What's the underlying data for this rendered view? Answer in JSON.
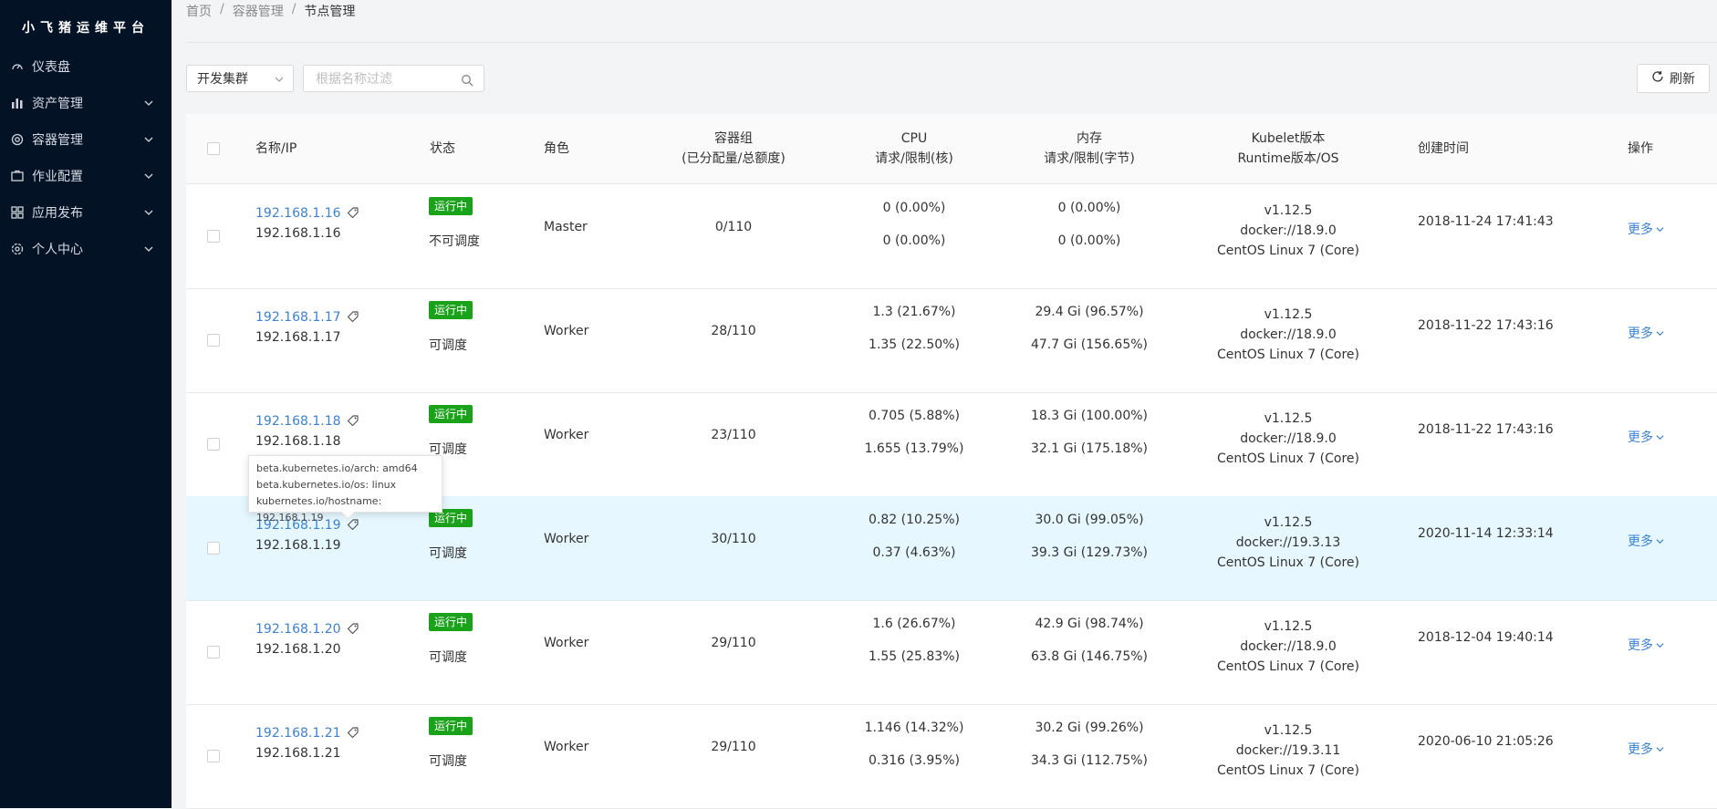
{
  "app": {
    "title": "小飞猪运维平台"
  },
  "sidebar": {
    "items": [
      {
        "label": "仪表盘",
        "icon": "dashboard-icon",
        "expandable": false
      },
      {
        "label": "资产管理",
        "icon": "bar-chart-icon",
        "expandable": true
      },
      {
        "label": "容器管理",
        "icon": "container-icon",
        "expandable": true
      },
      {
        "label": "作业配置",
        "icon": "job-icon",
        "expandable": true
      },
      {
        "label": "应用发布",
        "icon": "app-icon",
        "expandable": true
      },
      {
        "label": "个人中心",
        "icon": "user-settings-icon",
        "expandable": true
      }
    ]
  },
  "breadcrumb": [
    "首页",
    "容器管理",
    "节点管理"
  ],
  "toolbar": {
    "cluster_select": "开发集群",
    "search_placeholder": "根据名称过滤",
    "refresh_label": "刷新"
  },
  "table": {
    "headers": {
      "name": "名称/IP",
      "status": "状态",
      "role": "角色",
      "pods_1": "容器组",
      "pods_2": "(已分配量/总额度)",
      "cpu_1": "CPU",
      "cpu_2": "请求/限制(核)",
      "mem_1": "内存",
      "mem_2": "请求/限制(字节)",
      "kubelet_1": "Kubelet版本",
      "kubelet_2": "Runtime版本/OS",
      "created": "创建时间",
      "actions": "操作"
    },
    "rows": [
      {
        "name": "192.168.1.16",
        "ip": "192.168.1.16",
        "status": "运行中",
        "schedule": "不可调度",
        "role": "Master",
        "pods": "0/110",
        "cpu_req": "0 (0.00%)",
        "cpu_lim": "0 (0.00%)",
        "mem_req": "0 (0.00%)",
        "mem_lim": "0 (0.00%)",
        "kubelet": "v1.12.5",
        "runtime": "docker://18.9.0",
        "os": "CentOS Linux 7 (Core)",
        "created": "2018-11-24 17:41:43",
        "action": "更多"
      },
      {
        "name": "192.168.1.17",
        "ip": "192.168.1.17",
        "status": "运行中",
        "schedule": "可调度",
        "role": "Worker",
        "pods": "28/110",
        "cpu_req": "1.3 (21.67%)",
        "cpu_lim": "1.35 (22.50%)",
        "mem_req": "29.4 Gi (96.57%)",
        "mem_lim": "47.7 Gi (156.65%)",
        "kubelet": "v1.12.5",
        "runtime": "docker://18.9.0",
        "os": "CentOS Linux 7 (Core)",
        "created": "2018-11-22 17:43:16",
        "action": "更多"
      },
      {
        "name": "192.168.1.18",
        "ip": "192.168.1.18",
        "status": "运行中",
        "schedule": "可调度",
        "role": "Worker",
        "pods": "23/110",
        "cpu_req": "0.705 (5.88%)",
        "cpu_lim": "1.655 (13.79%)",
        "mem_req": "18.3 Gi (100.00%)",
        "mem_lim": "32.1 Gi (175.18%)",
        "kubelet": "v1.12.5",
        "runtime": "docker://18.9.0",
        "os": "CentOS Linux 7 (Core)",
        "created": "2018-11-22 17:43:16",
        "action": "更多"
      },
      {
        "name": "192.168.1.19",
        "ip": "192.168.1.19",
        "status": "运行中",
        "schedule": "可调度",
        "role": "Worker",
        "pods": "30/110",
        "cpu_req": "0.82 (10.25%)",
        "cpu_lim": "0.37 (4.63%)",
        "mem_req": "30.0 Gi (99.05%)",
        "mem_lim": "39.3 Gi (129.73%)",
        "kubelet": "v1.12.5",
        "runtime": "docker://19.3.13",
        "os": "CentOS Linux 7 (Core)",
        "created": "2020-11-14 12:33:14",
        "action": "更多"
      },
      {
        "name": "192.168.1.20",
        "ip": "192.168.1.20",
        "status": "运行中",
        "schedule": "可调度",
        "role": "Worker",
        "pods": "29/110",
        "cpu_req": "1.6 (26.67%)",
        "cpu_lim": "1.55 (25.83%)",
        "mem_req": "42.9 Gi (98.74%)",
        "mem_lim": "63.8 Gi (146.75%)",
        "kubelet": "v1.12.5",
        "runtime": "docker://18.9.0",
        "os": "CentOS Linux 7 (Core)",
        "created": "2018-12-04 19:40:14",
        "action": "更多"
      },
      {
        "name": "192.168.1.21",
        "ip": "192.168.1.21",
        "status": "运行中",
        "schedule": "可调度",
        "role": "Worker",
        "pods": "29/110",
        "cpu_req": "1.146 (14.32%)",
        "cpu_lim": "0.316 (3.95%)",
        "mem_req": "30.2 Gi (99.26%)",
        "mem_lim": "34.3 Gi (112.75%)",
        "kubelet": "v1.12.5",
        "runtime": "docker://19.3.11",
        "os": "CentOS Linux 7 (Core)",
        "created": "2020-06-10 21:05:26",
        "action": "更多"
      }
    ]
  },
  "tooltip": {
    "lines": [
      "beta.kubernetes.io/arch: amd64",
      "beta.kubernetes.io/os: linux",
      "kubernetes.io/hostname: 192.168.1.19"
    ]
  },
  "colors": {
    "sidebar_bg": "#041226",
    "link": "#3b82d6",
    "status_running": "#1aa31a",
    "row_highlight": "#e6f7ff"
  }
}
